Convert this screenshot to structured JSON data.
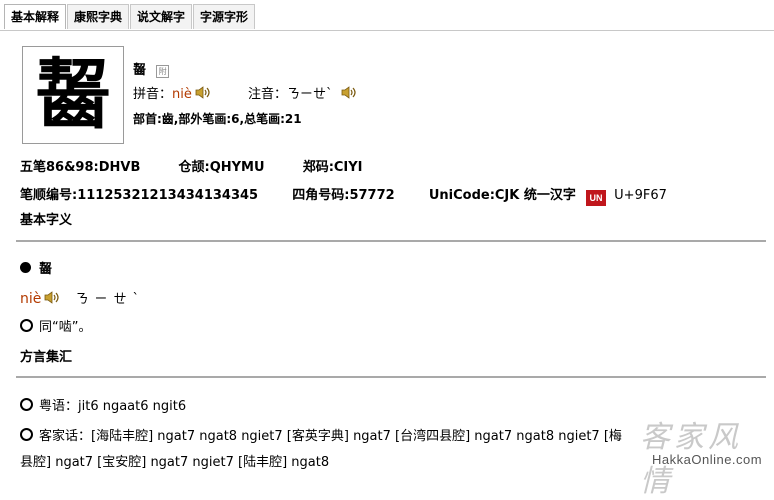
{
  "tabs": [
    "基本解释",
    "康熙字典",
    "说文解字",
    "字源字形"
  ],
  "character": "齧",
  "header": {
    "char_small": "齧",
    "pinyin_label": "拼音：",
    "pinyin_value": "niè",
    "zhuyin_label": "注音：",
    "zhuyin_value": "ㄋㄧㄝˋ",
    "radical_line": "部首:齒,部外笔画:6,总笔画:21"
  },
  "info": {
    "wubi": "五笔86&98:DHVB",
    "cangjie": "仓颉:QHYMU",
    "zhengma": "郑码:CIYI",
    "bishun": "笔顺编号:11125321213434134345",
    "sijiao": "四角号码:57772",
    "unicode_label": "UniCode:CJK 统一汉字",
    "unicode_logo": "UN",
    "unicode_value": "U+9F67"
  },
  "basic": {
    "section_title": "基本字义",
    "entry_char": "齧",
    "entry_pinyin": "niè",
    "entry_zhuyin": "ㄋㄧㄝˋ",
    "definition": "同“啮”。"
  },
  "dialect": {
    "section_title": "方言集汇",
    "cantonese": "粤语：jit6 ngaat6 ngit6",
    "hakka_line1": "客家话：[海陆丰腔] ngat7 ngat8 ngiet7 [客英字典] ngat7 [台湾四县腔] ngat7 ngat8 ngiet7 [梅",
    "hakka_line2": "县腔] ngat7 [宝安腔] ngat7 ngiet7 [陆丰腔] ngat8"
  },
  "watermark": {
    "calligraphy": "客家风情",
    "site": "HakkaOnline.com"
  },
  "icons": [
    "speaker-icon",
    "reference-icon",
    "unicode-logo-icon",
    "bullet-icon",
    "circle-bullet-icon"
  ]
}
